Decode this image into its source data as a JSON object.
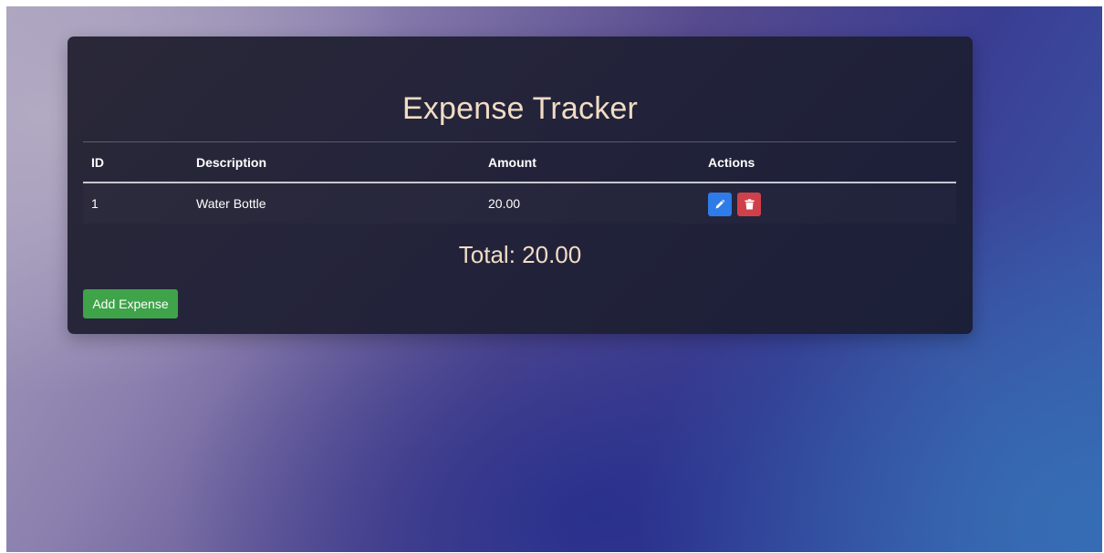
{
  "app": {
    "title": "Expense Tracker"
  },
  "table": {
    "headers": {
      "id": "ID",
      "description": "Description",
      "amount": "Amount",
      "actions": "Actions"
    },
    "rows": [
      {
        "id": "1",
        "description": "Water Bottle",
        "amount": "20.00",
        "actions": [
          "edit-icon",
          "trash-icon"
        ]
      }
    ]
  },
  "summary": {
    "total_label": "Total: 20.00"
  },
  "buttons": {
    "add_expense_label": "Add Expense"
  },
  "colors": {
    "title": "#f1dcc4",
    "edit": "#2f7be8",
    "delete": "#d0404a",
    "add": "#3fa34a"
  }
}
